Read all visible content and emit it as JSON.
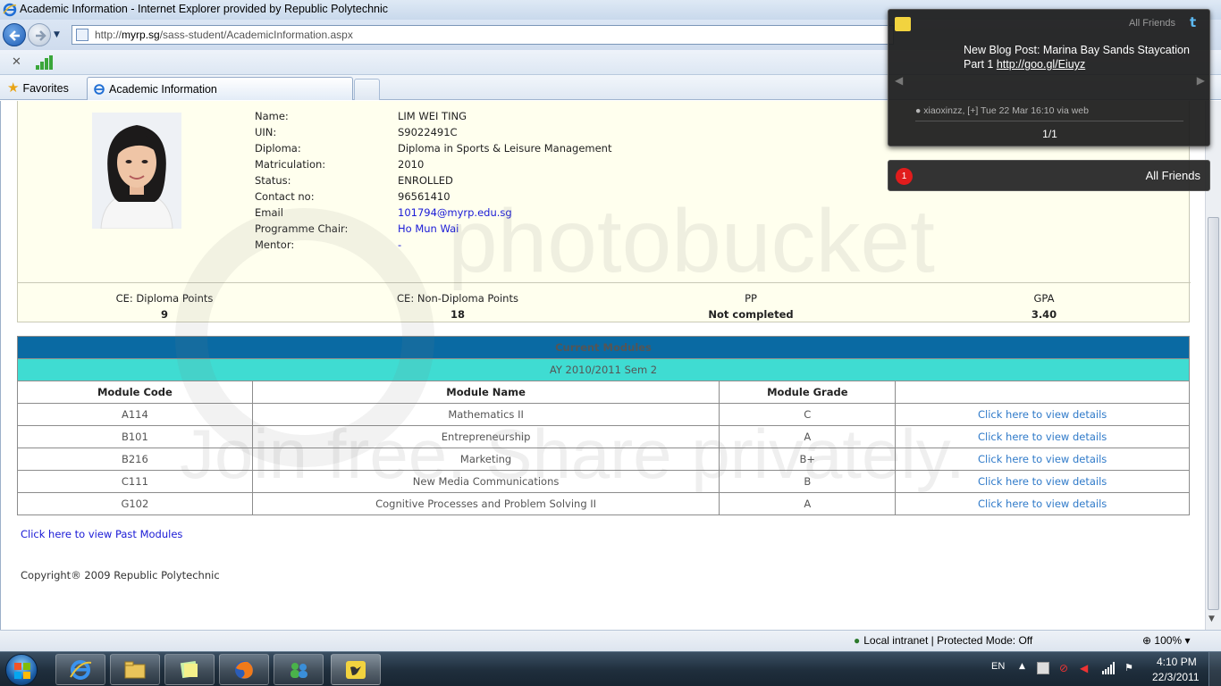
{
  "window": {
    "title": "Academic Information - Internet Explorer provided by Republic Polytechnic",
    "url_prefix": "http://",
    "url_host": "myrp.sg",
    "url_path": "/sass-student/AcademicInformation.aspx"
  },
  "favorites": {
    "label": "Favorites"
  },
  "tab": {
    "label": "Academic Information"
  },
  "profile": {
    "fields": [
      {
        "label": "Name:",
        "value": "LIM WEI TING"
      },
      {
        "label": "UIN:",
        "value": "S9022491C"
      },
      {
        "label": "Diploma:",
        "value": "Diploma in Sports & Leisure Management"
      },
      {
        "label": "Matriculation:",
        "value": "2010"
      },
      {
        "label": "Status:",
        "value": "ENROLLED"
      },
      {
        "label": "Contact no:",
        "value": "96561410"
      },
      {
        "label": "Email",
        "value": "101794@myrp.edu.sg"
      },
      {
        "label": "Programme Chair:",
        "value": "Ho Mun Wai"
      },
      {
        "label": "Mentor:",
        "value": "-"
      }
    ],
    "stats": [
      {
        "label": "CE: Diploma Points",
        "value": "9"
      },
      {
        "label": "CE: Non-Diploma Points",
        "value": "18"
      },
      {
        "label": "PP",
        "value": "Not completed"
      },
      {
        "label": "GPA",
        "value": "3.40"
      }
    ]
  },
  "modules": {
    "title": "Current Modules",
    "term": "AY 2010/2011 Sem 2",
    "columns": [
      "Module Code",
      "Module Name",
      "Module Grade"
    ],
    "rows": [
      {
        "code": "A114",
        "name": "Mathematics II",
        "grade": "C",
        "link": "Click here to view details"
      },
      {
        "code": "B101",
        "name": "Entrepreneurship",
        "grade": "A",
        "link": "Click here to view details"
      },
      {
        "code": "B216",
        "name": "Marketing",
        "grade": "B+",
        "link": "Click here to view details"
      },
      {
        "code": "C111",
        "name": "New Media Communications",
        "grade": "B",
        "link": "Click here to view details"
      },
      {
        "code": "G102",
        "name": "Cognitive Processes and Problem Solving II",
        "grade": "A",
        "link": "Click here to view details"
      }
    ]
  },
  "footer": {
    "past_modules": "Click here to view Past Modules",
    "copyright": "Copyright® 2009 Republic Polytechnic"
  },
  "watermark": {
    "brand": "photobucket",
    "slogan": "Join free. Share privately."
  },
  "statusbar": {
    "zone": "Local intranet | Protected Mode: Off",
    "zoom": "100%"
  },
  "taskbar": {
    "lang": "EN",
    "time": "4:10 PM",
    "date": "22/3/2011"
  },
  "notification": {
    "source": "All Friends",
    "message": "New Blog Post: Marina Bay Sands Staycation Part 1",
    "link": "http://goo.gl/Eiuyz",
    "meta": "● xiaoxinzz, [+] Tue 22 Mar 16:10 via web",
    "count": "1/1",
    "badge": "1",
    "bar_label": "All Friends"
  },
  "colors": {
    "modules_header": "#0a6aa3",
    "term_row": "#3fdcd2",
    "profile_bg": "#ffffee",
    "link": "#1a1ad6"
  },
  "icons": [
    "ie-logo-icon",
    "back-arrow-icon",
    "forward-arrow-icon",
    "star-icon",
    "signal-icon",
    "windows-logo-icon",
    "twitter-icon",
    "globe-icon"
  ]
}
